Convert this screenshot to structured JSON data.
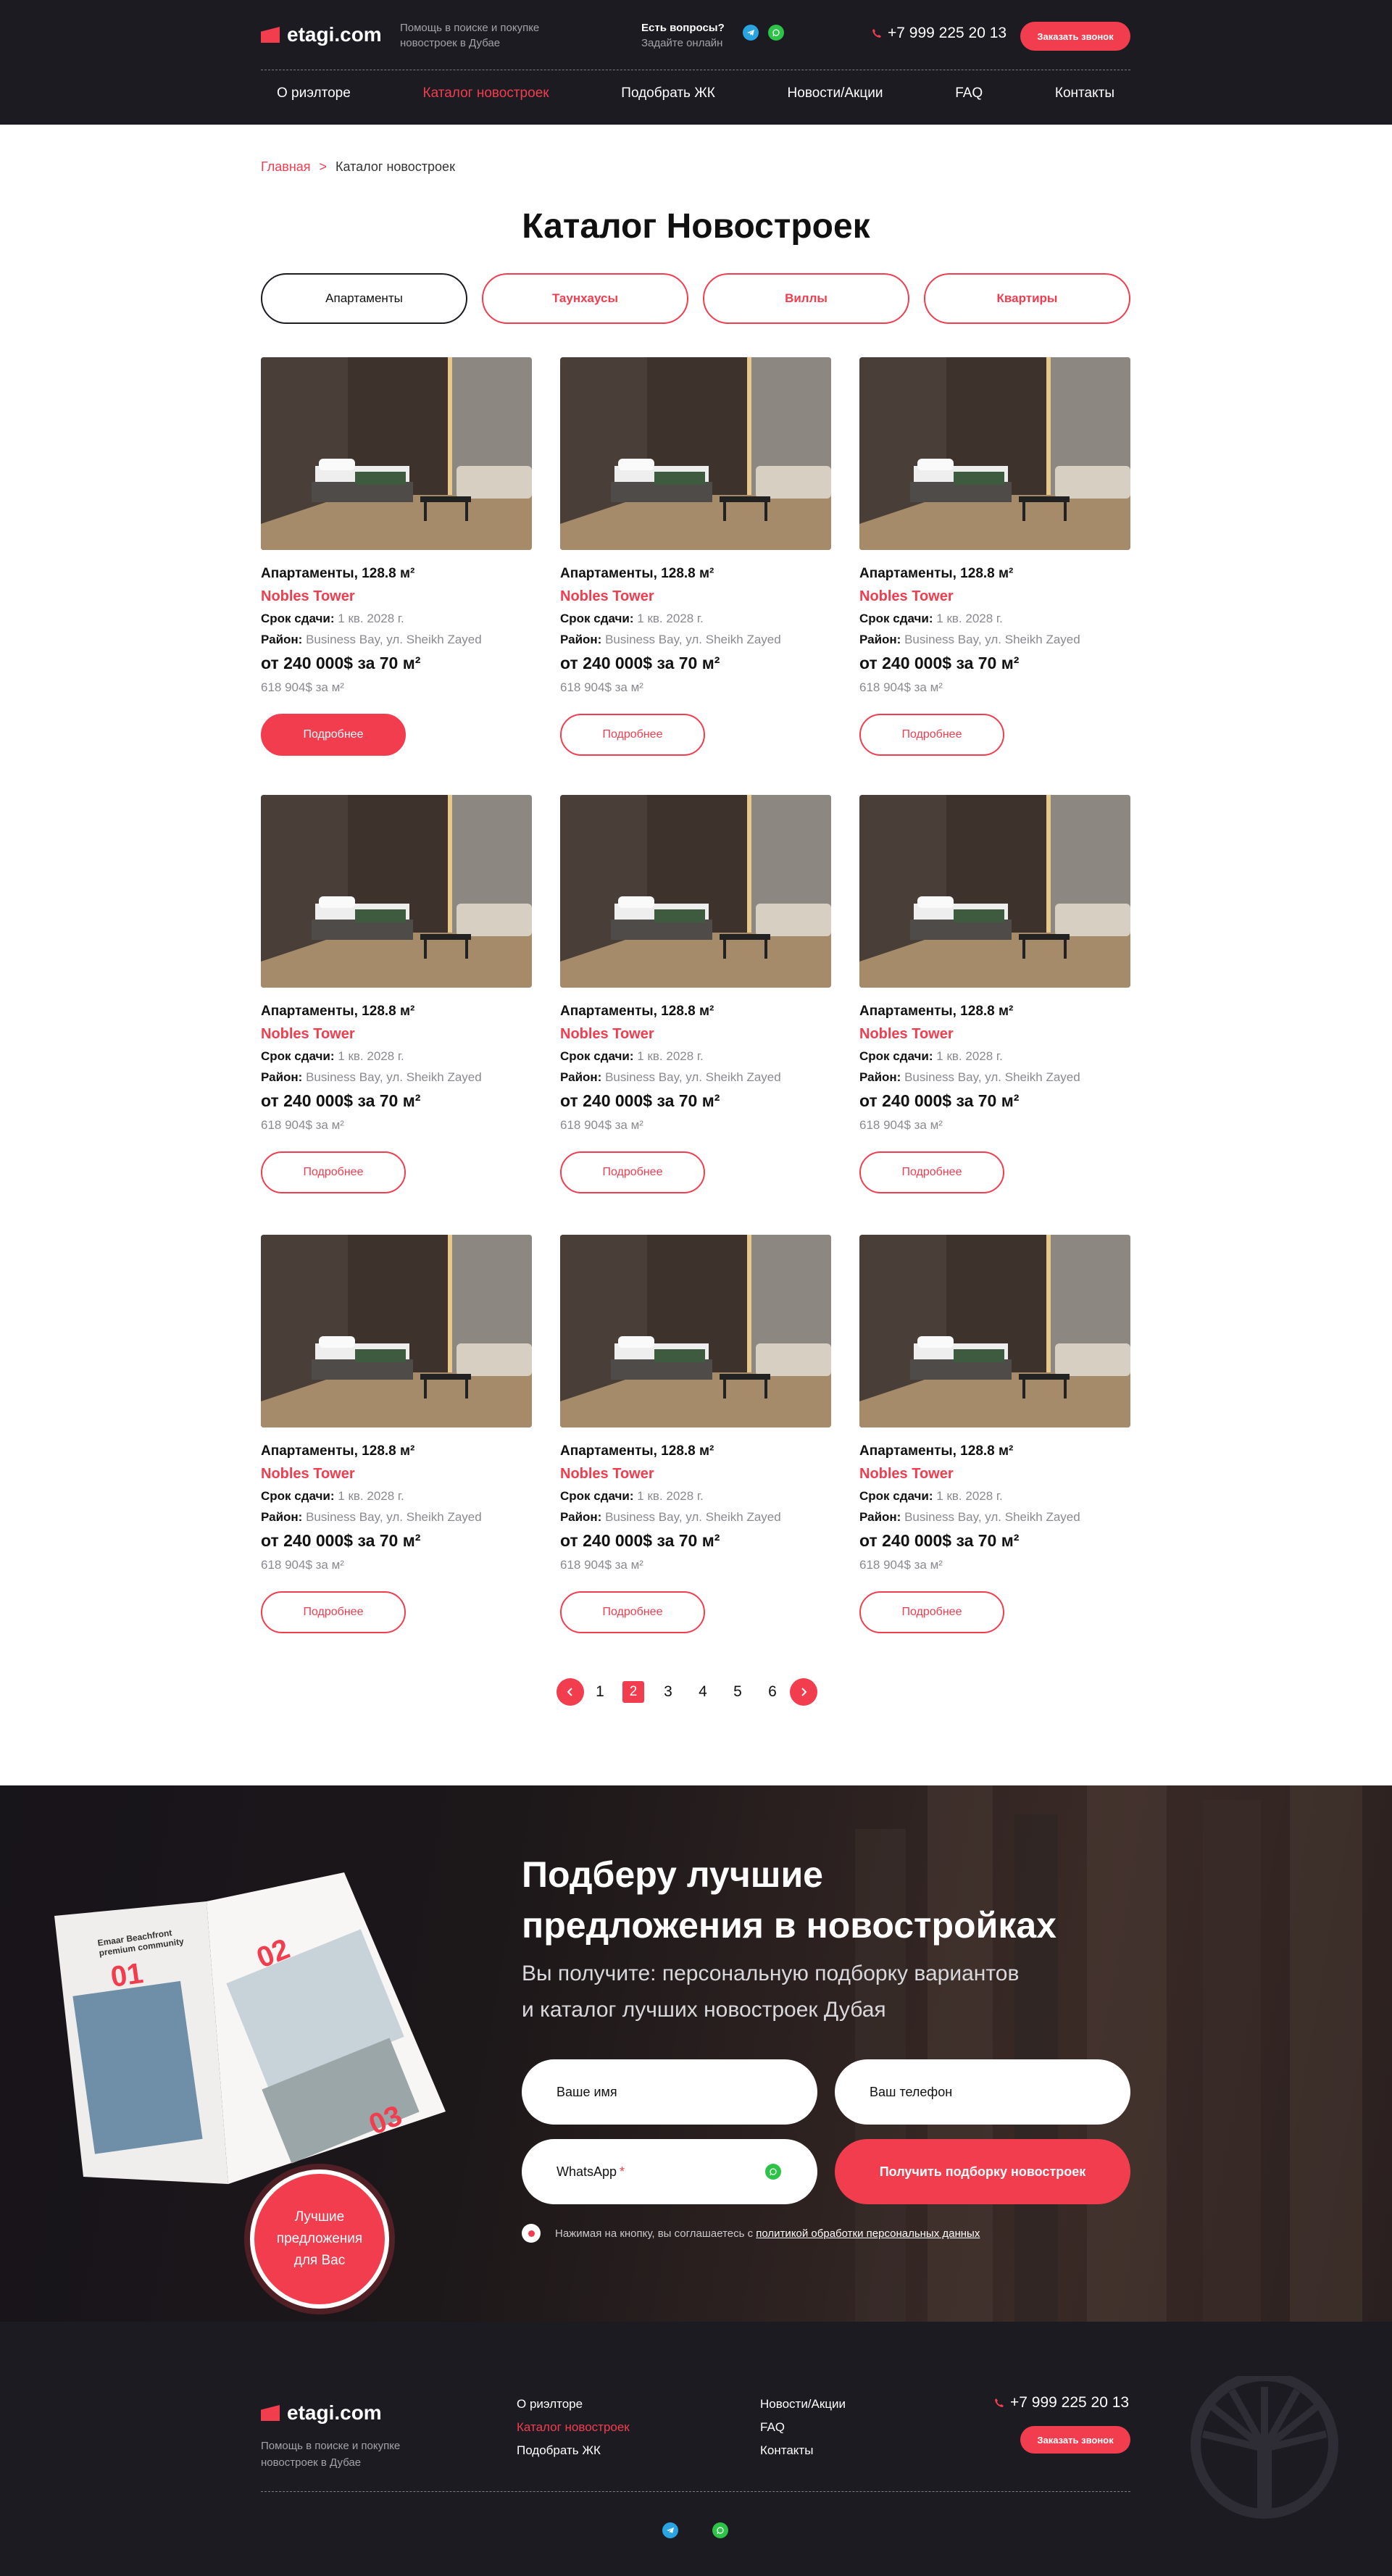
{
  "header": {
    "logo": "etagi.com",
    "tagline": "Помощь в поиске и покупке новостроек в Дубае",
    "questions_title": "Есть вопросы?",
    "questions_sub": "Задайте онлайн",
    "phone": "+7 999 225 20 13",
    "call_button": "Заказать звонок",
    "nav": [
      "О риэлторе",
      "Каталог новостроек",
      "Подобрать  ЖК",
      "Новости/Акции",
      "FAQ",
      "Контакты"
    ]
  },
  "breadcrumb": {
    "home": "Главная",
    "sep": ">",
    "current": "Каталог новостроек"
  },
  "page_title": "Каталог Новостроек",
  "tabs": [
    "Апартаменты",
    "Таунхаусы",
    "Виллы",
    "Квартиры"
  ],
  "card": {
    "title": "Апартаменты, 128.8 м²",
    "name": "Nobles Tower",
    "deadline_label": "Срок сдачи:",
    "deadline_value": "1 кв. 2028 г.",
    "district_label": "Район:",
    "district_value": "Business Bay, ул. Sheikh Zayed",
    "price": "от 240 000$ за 70 м²",
    "price_per_m": "618 904$ за м²",
    "more": "Подробнее"
  },
  "pagination": {
    "pages": [
      "1",
      "2",
      "3",
      "4",
      "5",
      "6"
    ],
    "current": "2"
  },
  "promo": {
    "title_line1": "Подберу лучшие",
    "title_line2": "предложения в новостройках",
    "sub_line1": "Вы получите: персональную подборку вариантов",
    "sub_line2": "и каталог лучших новостроек Дубая",
    "name_placeholder": "Ваше имя",
    "phone_placeholder": "Ваш телефон",
    "messenger": "WhatsApp",
    "required_mark": "*",
    "submit": "Получить подборку новостроек",
    "agree_text": "Нажимая на кнопку, вы соглашаетесь с",
    "agree_link": "политикой обработки персональных данных",
    "badge_line1": "Лучшие",
    "badge_line2": "предложения",
    "badge_line3": "для Вас",
    "book_title": "Emaar Beachfront premium community",
    "book_n1": "01",
    "book_n2": "02",
    "book_n3": "03"
  },
  "footer": {
    "logo": "etagi.com",
    "tagline_line1": "Помощь в поиске и покупке",
    "tagline_line2": "новостроек в Дубае",
    "col1": [
      "О риэлторе",
      "Каталог новостроек",
      "Подобрать  ЖК"
    ],
    "col2": [
      "Новости/Акции",
      "FAQ",
      "Контакты"
    ],
    "phone": "+7 999 225 20 13",
    "call_button": "Заказать звонок"
  },
  "colors": {
    "accent": "#f23d4f",
    "dark": "#1c1b22"
  }
}
